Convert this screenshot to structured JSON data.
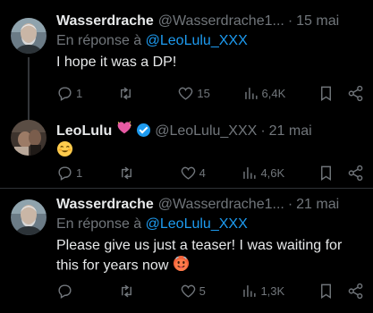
{
  "tweets": [
    {
      "name": "Wasserdrache",
      "handle": "@Wasserdrache1...",
      "date": "15 mai",
      "reply_prefix": "En réponse à",
      "reply_to": "@LeoLulu_XXX",
      "text": "I hope it was a DP!",
      "replies": "1",
      "retweets": "",
      "likes": "15",
      "views": "6,4K"
    },
    {
      "name": "LeoLulu",
      "handle": "@LeoLulu_XXX",
      "date": "21 mai",
      "emoji_name": "sparkling-heart-icon",
      "text_emoji": "smiling-face-icon",
      "replies": "1",
      "retweets": "",
      "likes": "4",
      "views": "4,6K"
    },
    {
      "name": "Wasserdrache",
      "handle": "@Wasserdrache1...",
      "date": "21 mai",
      "reply_prefix": "En réponse à",
      "reply_to": "@LeoLulu_XXX",
      "text": "Please give us just a teaser! I was waiting for this for years now",
      "replies": "",
      "retweets": "",
      "likes": "5",
      "views": "1,3K"
    }
  ],
  "separator": "·",
  "colors": {
    "background": "#000000",
    "text": "#e7e9ea",
    "muted": "#71767b",
    "link": "#1d9bf0",
    "verified": "#1d9bf0"
  }
}
